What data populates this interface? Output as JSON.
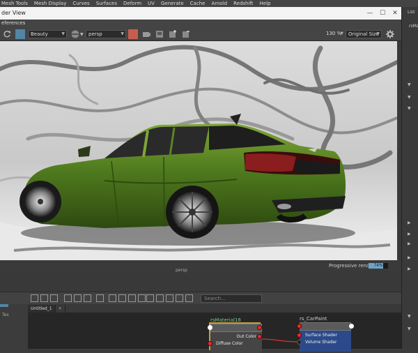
{
  "maya_menu": [
    "Mesh Tools",
    "Mesh Display",
    "Curves",
    "Surfaces",
    "Deform",
    "UV",
    "Generate",
    "Cache",
    "Arnold",
    "Redshift",
    "Help"
  ],
  "render_view": {
    "title": "der View",
    "menu": "eferences",
    "window_controls": [
      "—",
      "☐",
      "✕"
    ],
    "aov_select": "Beauty",
    "camera_select": "persp",
    "zoom": "130 %",
    "size_select": "Original Size",
    "status": "Progressive rendering",
    "progress_value": 0.74,
    "progress_label": "74%",
    "accent_color": "#5285a6",
    "render_active_color": "#c75e4d"
  },
  "right_panel": {
    "top_label": "List",
    "side_label": "rsMa"
  },
  "lower": {
    "persp_label": "persp",
    "left_tabs_label": "Tex",
    "search_placeholder": "Search...",
    "tabs": [
      "Untitled_1",
      "+"
    ]
  },
  "nodes": [
    {
      "title": "rsMaterial18",
      "out_label": "Out Color",
      "in_label": "Diffuse Color",
      "title_color": "#7ec48a"
    },
    {
      "title": "rs_CarPaint",
      "rows": [
        "Surface Shader",
        "Volume Shader"
      ],
      "title_color": "#cfcfcf"
    }
  ],
  "icons": [
    "refresh-icon",
    "render-icon",
    "snapshot-icon",
    "save-image-icon",
    "keep-image-icon",
    "remove-image-icon",
    "settings-icon"
  ]
}
